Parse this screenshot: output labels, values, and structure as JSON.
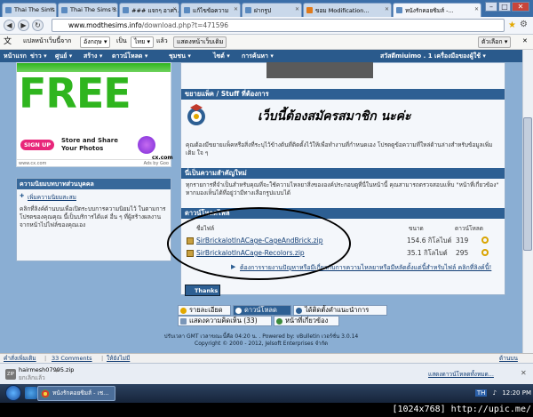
{
  "browser": {
    "tabs": [
      {
        "label": "Thai The Sims ..."
      },
      {
        "label": "Thai The Sims 3..."
      },
      {
        "label": "### แจกๆ อาคา..."
      },
      {
        "label": "แก้ไขข้อความ"
      },
      {
        "label": "ฝากรูป"
      },
      {
        "label": "ขอม Modification..."
      },
      {
        "label": "หนังรักคอยซิมส์ -..."
      }
    ],
    "url_host": "www.modthesims.info",
    "url_path": "/download.php?t=471596",
    "window_buttons": [
      "–",
      "□",
      "✕"
    ]
  },
  "translate_bar": {
    "prefix": "แปลหน้าเว็บนี้จาก",
    "from_lang": "อังกฤษ ▾",
    "to_word": "เป็น",
    "to_lang": "ไทย ▾",
    "then_word": "แล้ว",
    "show_original": "แสดงหน้าเว็บเดิม",
    "options": "ตัวเลือก ▾"
  },
  "site_nav": {
    "items": [
      "หน้าแรก",
      "ข่าว ▾",
      "ศูนย์ ▾",
      "สร้าง ▾",
      "ดาวน์โหลด ▾",
      "ชุมชน ▾",
      "ไซต์ ▾",
      "การค้นหา ▾"
    ],
    "welcome": "สวัสดีmiuimo . 1 เครื่องมือของผู้ใช้ ▾"
  },
  "ad": {
    "headline": "FREE",
    "signup": "SIGN UP",
    "tagline": "Store and Share Your Photos",
    "brand": "cx.com",
    "footer_left": "www.cx.com",
    "footer_right": "Ads by Goo"
  },
  "left_panel": {
    "title": "ความนิยมบทบาทส่วนบุคคล",
    "link": "เพิ่มความนิยมสะสม",
    "body": "คลิกที่ลิงค์ด้านบนเพื่อเปิดระบบการความนิยมไว้ ในตามการโปรดของคุณคุณ นี้เป็นบริการได้แค่ อื่น ๆ ที่ผู้สร้างผลงานจากหน้าไปไฟล์ของคุณเอง"
  },
  "main": {
    "section1_title": "ขยายแพ็ค / Stuff ที่ต้องการ",
    "warning_text": "เว็บนี้ต้องสมัครสมาชิก นะค่ะ",
    "section1_text": "คุณต้องมีขยายแพ็คหรือสิ่งที่ระบุไว้ข้างต้นที่ติดตั้งไว้ให้เพื่อทำงานที่กำหนดเอง โปรดดูข้อความที่ใหล่ด้านล่างสำหรับข้อมูลเพิ่มเติม ใจ ๆ",
    "section2_title": "นี่เป็นความสำคัญใหม่",
    "section2_text": "ทุกรายการที่จำเป็นสำหรับคุณที่จะใช้ความไหลยาสิ่งขององค์ประกอบดูที่นี่ในหน้านี้ คุณสามารถตรวจสอบแท็บ \"หน้าที่เกี่ยวข้อง\" หากมองเห็นได้ที่อยู่ว่ามีทางเลือกรูปแบบได้",
    "section3_title": "ดาวน์โหลดไฟล์",
    "files_header": {
      "name": "ชื่อไฟล์",
      "size": "ขนาด",
      "downloads": "ดาวน์โหลด"
    },
    "files": [
      {
        "name": "SirBrickalotInACage-CageAndBrick.zip",
        "size": "154.6 กิโลไบต์",
        "count": "319"
      },
      {
        "name": "SirBrickalotInACage-Recolors.zip",
        "size": "35.1 กิโลไบต์",
        "count": "295"
      }
    ],
    "report_link": "ต้องการรายงานปัญหาหรือมีเกี่ยวกับการความไหลยาหรือมีหลัดตั้งแต่นี้สำหรับไฟล์ คลิกที่ลิงค์นี้!",
    "thanks": "Thanks"
  },
  "bottom_tabs": [
    {
      "label": "รายละเอียด"
    },
    {
      "label": "ดาวน์โหลด"
    },
    {
      "label": "ได้ติดตั้งคำแนะนำการ"
    },
    {
      "label": "แสดงความคิดเห็น (33)"
    },
    {
      "label": "หน้าที่เกี่ยวข้อง"
    }
  ],
  "footer": {
    "line1": "ปรับเวลา GMT เวลาขณะนี้คือ 04:20 น. . Powered by: vBulletin เวอร์ชั่น 3.0.14",
    "line2": "Copyright © 2000 - 2012, Jelsoft Enterprises จำกัด"
  },
  "status_bar": {
    "left1": "คำสั่งเพิ่มเติม",
    "left2": "33 Comments",
    "left3": "ให้ยังไม่มี",
    "right": "ด้านบน"
  },
  "download_shelf": {
    "filename": "hairmesh07995.zip",
    "status": "ยกเลิกแล้ว",
    "show_all": "แสดงดาวน์โหลดทั้งหมด...",
    "close": "✕"
  },
  "taskbar": {
    "task_label": "หนังรักคอยซิมส์ - เช...",
    "tray_lang": "TH",
    "clock": "12:20 PM"
  },
  "watermark": "[1024x768] http://upic.me/",
  "colors": {
    "page_bg": "#8aaed3",
    "section_header": "#2d5f93",
    "link": "#123e75",
    "ad_green": "#2fb51e",
    "ad_pink": "#e8267a"
  }
}
